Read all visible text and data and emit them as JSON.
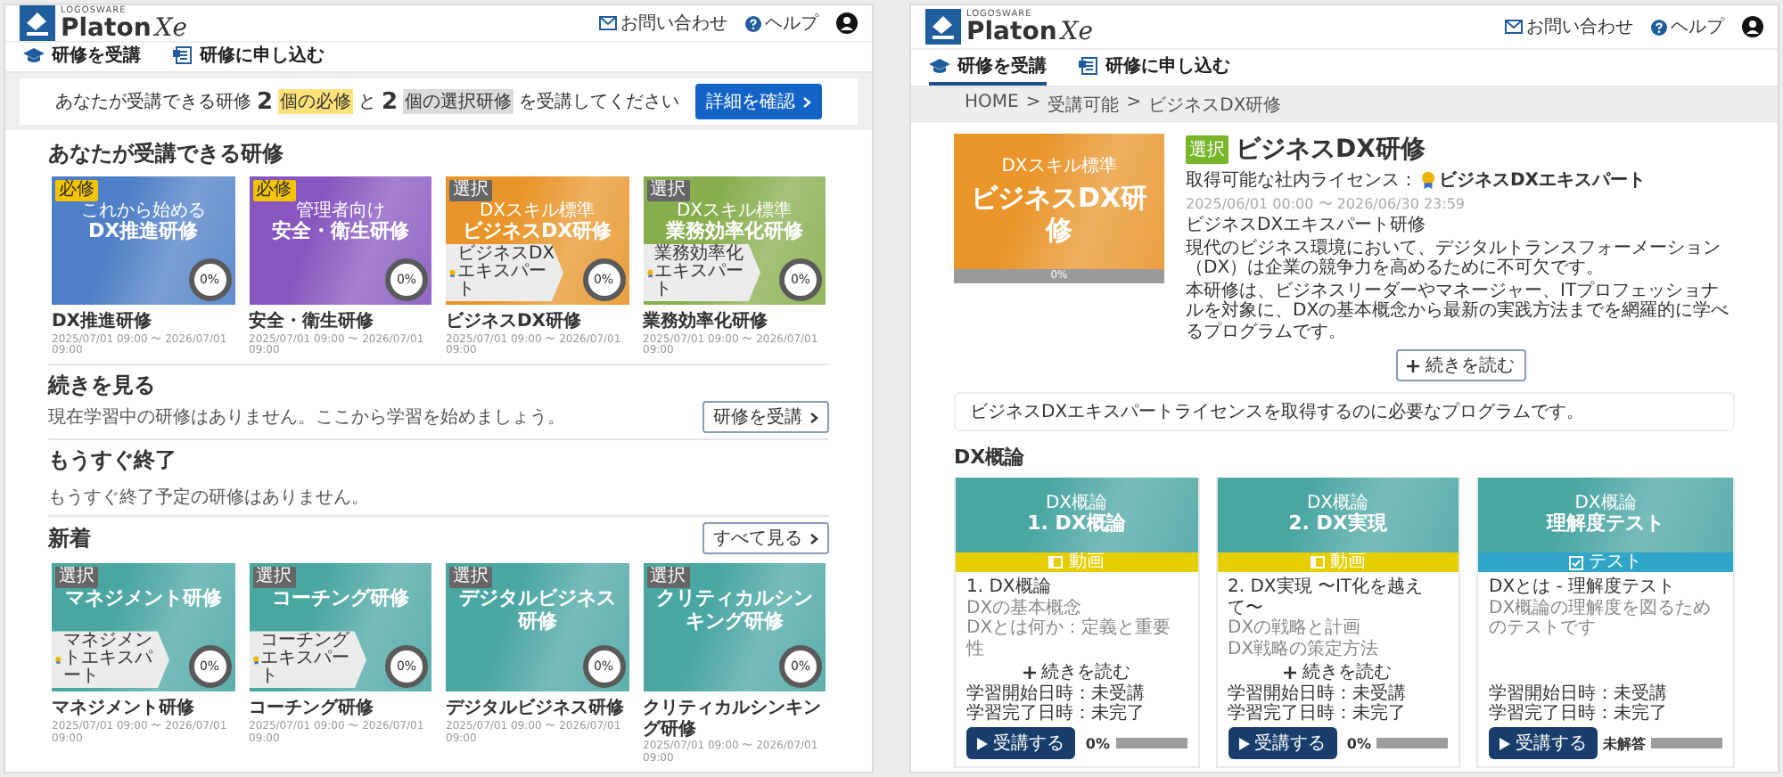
{
  "course_list_page": {
    "header": {
      "brand_small": "LOGOSWARE",
      "brand": "Platon",
      "brand_suffix": "Xe",
      "contact": "お問い合わせ",
      "help": "ヘルプ"
    },
    "nav": [
      {
        "label": "研修を受講",
        "selected": false
      },
      {
        "label": "研修に申し込む",
        "selected": false
      }
    ],
    "banner": {
      "prefix": "あなたが受講できる研修",
      "required_count": "2",
      "required_label": "個の必修",
      "conjunction": "と",
      "elective_count": "2",
      "elective_label": "個の選択研修",
      "suffix": "を受講してください",
      "button": "詳細を確認"
    },
    "available": {
      "title": "あなたが受講できる研修",
      "courses": [
        {
          "tag": "必修",
          "kind": "required",
          "color": "#4f7fc6",
          "image_subtitle": "これから始める",
          "image_title": "DX推進研修",
          "progress": "0%",
          "title": "DX推進研修",
          "period": "2025/07/01 09:00 〜 2026/07/01 09:00"
        },
        {
          "tag": "必修",
          "kind": "required",
          "color": "#8757bf",
          "image_subtitle": "管理者向け",
          "image_title": "安全・衛生研修",
          "progress": "0%",
          "title": "安全・衛生研修",
          "period": "2025/07/01 09:00 〜 2026/07/01 09:00"
        },
        {
          "tag": "選択",
          "kind": "elective",
          "color": "#e9952a",
          "image_subtitle": "DXスキル標準",
          "image_title": "ビジネスDX研修",
          "badge": "ビジネスDXエキスパート",
          "progress": "0%",
          "title": "ビジネスDX研修",
          "period": "2025/07/01 09:00 〜 2026/07/01 09:00"
        },
        {
          "tag": "選択",
          "kind": "elective",
          "color": "#86ae4c",
          "image_subtitle": "DXスキル標準",
          "image_title": "業務効率化研修",
          "badge": "業務効率化エキスパート",
          "progress": "0%",
          "title": "業務効率化研修",
          "period": "2025/07/01 09:00 〜 2026/07/01 09:00"
        }
      ]
    },
    "continue": {
      "title": "続きを見る",
      "text": "現在学習中の研修はありません。ここから学習を始めましょう。",
      "button": "研修を受講"
    },
    "ending_soon": {
      "title": "もうすぐ終了",
      "text": "もうすぐ終了予定の研修はありません。"
    },
    "new": {
      "title": "新着",
      "button": "すべて見る",
      "courses": [
        {
          "tag": "選択",
          "kind": "elective",
          "color": "#4aa6a3",
          "image_title": "マネジメント研修",
          "badge": "マネジメントエキスパート",
          "progress": "0%",
          "title": "マネジメント研修",
          "period": "2025/07/01 09:00 〜 2026/07/01 09:00"
        },
        {
          "tag": "選択",
          "kind": "elective",
          "color": "#4aa6a3",
          "image_title": "コーチング研修",
          "badge": "コーチングエキスパート",
          "progress": "0%",
          "title": "コーチング研修",
          "period": "2025/07/01 09:00 〜 2026/07/01 09:00"
        },
        {
          "tag": "選択",
          "kind": "elective",
          "color": "#4aa6a3",
          "image_title": "デジタルビジネス研修",
          "progress": "0%",
          "title": "デジタルビジネス研修",
          "period": "2025/07/01 09:00 〜 2026/07/01 09:00"
        },
        {
          "tag": "選択",
          "kind": "elective",
          "color": "#4aa6a3",
          "image_title": "クリティカルシンキング研修",
          "progress": "0%",
          "title": "クリティカルシンキング研修",
          "period": "2025/07/01 09:00 〜 2026/07/01 09:00"
        }
      ]
    }
  },
  "course_detail_page": {
    "header": {
      "brand_small": "LOGOSWARE",
      "brand": "Platon",
      "brand_suffix": "Xe",
      "contact": "お問い合わせ",
      "help": "ヘルプ"
    },
    "nav": [
      {
        "label": "研修を受講",
        "selected": true
      },
      {
        "label": "研修に申し込む",
        "selected": false
      }
    ],
    "breadcrumb": {
      "separator": ">",
      "items": [
        "HOME",
        "受講可能",
        "ビジネスDX研修"
      ]
    },
    "course": {
      "color": "#e9952a",
      "image_subtitle": "DXスキル標準",
      "image_title": "ビジネスDX研修",
      "progress": "0%",
      "level": 0,
      "tag": "選択",
      "kind": "elective",
      "title": "ビジネスDX研修",
      "license_label": "取得可能な社内ライセンス：",
      "license": "ビジネスDXエキスパート",
      "period": "2025/06/01 00:00 〜 2026/06/30 23:59",
      "description": [
        "ビジネスDXエキスパート研修",
        "現代のビジネス環境において、デジタルトランスフォーメーション（DX）は企業の競争力を高めるために不可欠です。",
        "本研修は、ビジネスリーダーやマネージャー、ITプロフェッショナルを対象に、DXの基本概念から最新の実践方法までを網羅的に学べるプログラムです。"
      ],
      "read_more": "続きを読む"
    },
    "note": "ビジネスDXエキスパートライセンスを取得するのに必要なプログラムです。",
    "chapter": "DX概論",
    "lessons": [
      {
        "kind": "video",
        "type_label": "動画",
        "image_subtitle": "DX概論",
        "image_title": "1. DX概論",
        "title": "1. DX概論",
        "subtitle": "DXの基本概念",
        "text": "DXとは何か：定義と重要性",
        "read_more": "続きを読む",
        "started": "学習開始日時：未受講",
        "completed": "学習完了日時：未完了",
        "button": "受講する",
        "status": "0%",
        "level": 0
      },
      {
        "kind": "video",
        "type_label": "動画",
        "image_subtitle": "DX概論",
        "image_title": "2. DX実現",
        "title": "2. DX実現 〜IT化を越えて〜",
        "subtitle": "DXの戦略と計画",
        "text": "DX戦略の策定方法",
        "read_more": "続きを読む",
        "started": "学習開始日時：未受講",
        "completed": "学習完了日時：未完了",
        "button": "受講する",
        "status": "0%",
        "level": 0
      },
      {
        "kind": "test",
        "type_label": "テスト",
        "image_subtitle": "DX概論",
        "image_title": "理解度テスト",
        "title": "DXとは - 理解度テスト",
        "subtitle": "DX概論の理解度を図るためのテストです",
        "started": "学習開始日時：未受講",
        "completed": "学習完了日時：未完了",
        "button": "受講する",
        "status": "未解答",
        "level": 0
      }
    ]
  }
}
